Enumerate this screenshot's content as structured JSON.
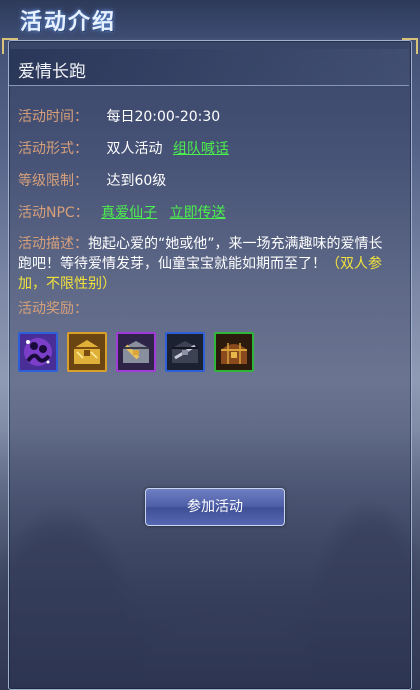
{
  "header": {
    "title": "活动介绍"
  },
  "activity": {
    "name": "爱情长跑",
    "time": {
      "label": "活动时间：",
      "value": "每日20:00-20:30"
    },
    "form": {
      "label": "活动形式：",
      "value": "双人活动",
      "link": "组队喊话"
    },
    "level": {
      "label": "等级限制：",
      "value": "达到60级"
    },
    "npc": {
      "label": "活动NPC：",
      "npc_link": "真爱仙子",
      "teleport_link": "立即传送"
    },
    "description": {
      "label": "活动描述：",
      "text": "抱起心爱的“她或他”，来一场充满趣味的爱情长跑吧！等待爱情发芽，仙童宝宝就能如期而至了！",
      "highlight": "（双人参加，不限性别）"
    },
    "rewards": {
      "label": "活动奖励：",
      "items": [
        {
          "icon": "purple-figure-icon",
          "border": "#2d5fd8"
        },
        {
          "icon": "gold-treasure-chest-icon",
          "border": "#d8a02a"
        },
        {
          "icon": "purple-treasure-chest-icon",
          "border": "#a23ad8"
        },
        {
          "icon": "blue-treasure-chest-icon",
          "border": "#2d5fd8"
        },
        {
          "icon": "wooden-treasure-chest-icon",
          "border": "#2fb63a"
        }
      ]
    }
  },
  "join_button": {
    "label": "参加活动"
  },
  "colors": {
    "label": "#d7a07a",
    "link": "#4cf04c",
    "highlight": "#f2e23c"
  }
}
